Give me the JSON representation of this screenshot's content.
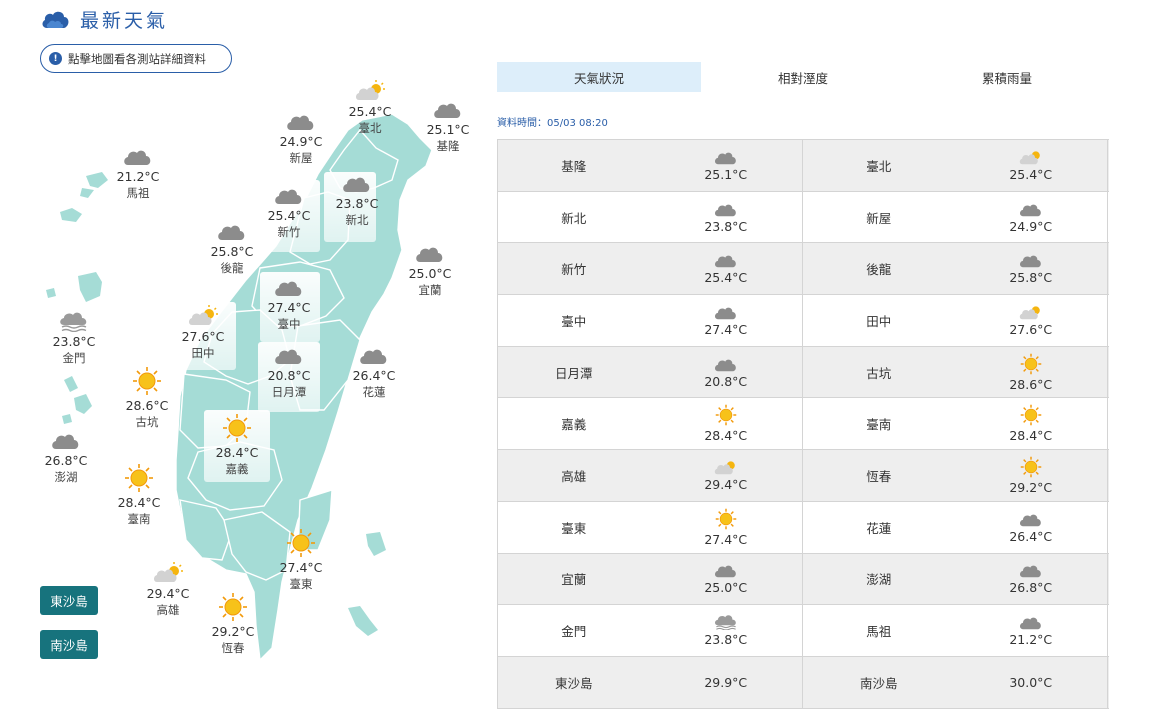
{
  "header": {
    "title": "最新天氣",
    "icon": "cloud-icon"
  },
  "info_button": {
    "label": "點擊地圖看各測站詳細資料",
    "icon": "info-icon"
  },
  "colors": {
    "brand_blue": "#2a5ea8",
    "map_land": "#a5dcd6",
    "island_button": "#17737d",
    "active_tab": "#ddeefa"
  },
  "map": {
    "stations": [
      {
        "id": "taipei",
        "name": "臺北",
        "temp": "25.4°C",
        "icon": "partly-cloudy"
      },
      {
        "id": "keelung",
        "name": "基隆",
        "temp": "25.1°C",
        "icon": "cloudy"
      },
      {
        "id": "xinwu",
        "name": "新屋",
        "temp": "24.9°C",
        "icon": "cloudy"
      },
      {
        "id": "matsu",
        "name": "馬祖",
        "temp": "21.2°C",
        "icon": "cloudy"
      },
      {
        "id": "hsinchu",
        "name": "新竹",
        "temp": "25.4°C",
        "icon": "cloudy"
      },
      {
        "id": "newtaipei",
        "name": "新北",
        "temp": "23.8°C",
        "icon": "cloudy"
      },
      {
        "id": "houlong",
        "name": "後龍",
        "temp": "25.8°C",
        "icon": "cloudy"
      },
      {
        "id": "yilan",
        "name": "宜蘭",
        "temp": "25.0°C",
        "icon": "cloudy"
      },
      {
        "id": "taichung",
        "name": "臺中",
        "temp": "27.4°C",
        "icon": "cloudy"
      },
      {
        "id": "tianzhong",
        "name": "田中",
        "temp": "27.6°C",
        "icon": "partly-cloudy"
      },
      {
        "id": "kinmen",
        "name": "金門",
        "temp": "23.8°C",
        "icon": "foggy"
      },
      {
        "id": "sunmoonlake",
        "name": "日月潭",
        "temp": "20.8°C",
        "icon": "cloudy"
      },
      {
        "id": "hualien",
        "name": "花蓮",
        "temp": "26.4°C",
        "icon": "cloudy"
      },
      {
        "id": "gukeng",
        "name": "古坑",
        "temp": "28.6°C",
        "icon": "sunny"
      },
      {
        "id": "chiayi",
        "name": "嘉義",
        "temp": "28.4°C",
        "icon": "sunny"
      },
      {
        "id": "penghu",
        "name": "澎湖",
        "temp": "26.8°C",
        "icon": "cloudy"
      },
      {
        "id": "tainan",
        "name": "臺南",
        "temp": "28.4°C",
        "icon": "sunny"
      },
      {
        "id": "taitung",
        "name": "臺東",
        "temp": "27.4°C",
        "icon": "sunny"
      },
      {
        "id": "kaohsiung",
        "name": "高雄",
        "temp": "29.4°C",
        "icon": "partly-cloudy"
      },
      {
        "id": "hengchun",
        "name": "恆春",
        "temp": "29.2°C",
        "icon": "sunny"
      }
    ],
    "island_buttons": [
      "東沙島",
      "南沙島"
    ]
  },
  "tabs": [
    {
      "label": "天氣狀況",
      "active": true
    },
    {
      "label": "相對溼度",
      "active": false
    },
    {
      "label": "累積雨量",
      "active": false
    }
  ],
  "data_time": "資料時間：05/03 08:20",
  "table": {
    "rows": [
      [
        {
          "name": "基隆",
          "temp": "25.1°C",
          "icon": "cloudy"
        },
        {
          "name": "臺北",
          "temp": "25.4°C",
          "icon": "partly-cloudy"
        }
      ],
      [
        {
          "name": "新北",
          "temp": "23.8°C",
          "icon": "cloudy"
        },
        {
          "name": "新屋",
          "temp": "24.9°C",
          "icon": "cloudy"
        }
      ],
      [
        {
          "name": "新竹",
          "temp": "25.4°C",
          "icon": "cloudy"
        },
        {
          "name": "後龍",
          "temp": "25.8°C",
          "icon": "cloudy"
        }
      ],
      [
        {
          "name": "臺中",
          "temp": "27.4°C",
          "icon": "cloudy"
        },
        {
          "name": "田中",
          "temp": "27.6°C",
          "icon": "partly-cloudy"
        }
      ],
      [
        {
          "name": "日月潭",
          "temp": "20.8°C",
          "icon": "cloudy"
        },
        {
          "name": "古坑",
          "temp": "28.6°C",
          "icon": "sunny"
        }
      ],
      [
        {
          "name": "嘉義",
          "temp": "28.4°C",
          "icon": "sunny"
        },
        {
          "name": "臺南",
          "temp": "28.4°C",
          "icon": "sunny"
        }
      ],
      [
        {
          "name": "高雄",
          "temp": "29.4°C",
          "icon": "partly-cloudy"
        },
        {
          "name": "恆春",
          "temp": "29.2°C",
          "icon": "sunny"
        }
      ],
      [
        {
          "name": "臺東",
          "temp": "27.4°C",
          "icon": "sunny"
        },
        {
          "name": "花蓮",
          "temp": "26.4°C",
          "icon": "cloudy"
        }
      ],
      [
        {
          "name": "宜蘭",
          "temp": "25.0°C",
          "icon": "cloudy"
        },
        {
          "name": "澎湖",
          "temp": "26.8°C",
          "icon": "cloudy"
        }
      ],
      [
        {
          "name": "金門",
          "temp": "23.8°C",
          "icon": "foggy"
        },
        {
          "name": "馬祖",
          "temp": "21.2°C",
          "icon": "cloudy"
        }
      ],
      [
        {
          "name": "東沙島",
          "temp": "29.9°C",
          "icon": ""
        },
        {
          "name": "南沙島",
          "temp": "30.0°C",
          "icon": ""
        }
      ]
    ]
  }
}
